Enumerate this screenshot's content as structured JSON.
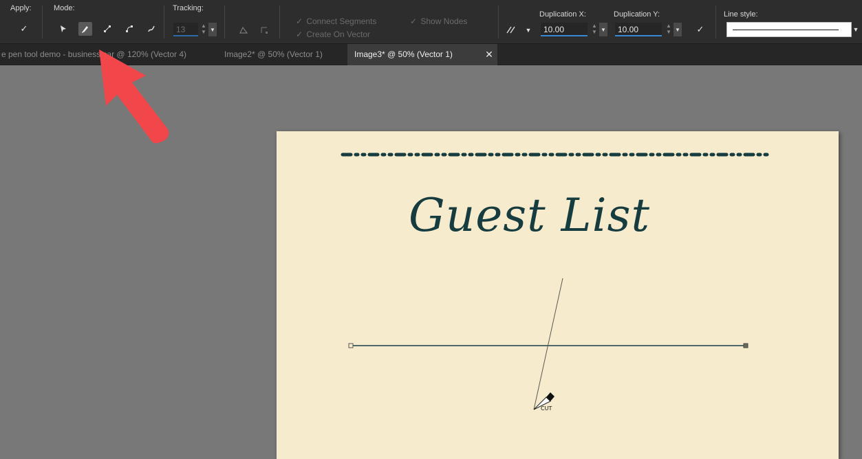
{
  "toolbar": {
    "apply_label": "Apply:",
    "apply_icon": "checkmark-icon",
    "mode_label": "Mode:",
    "mode_icons": [
      "node-edit-icon",
      "pen-icon",
      "line-segment-icon",
      "curve-segment-icon",
      "freehand-icon"
    ],
    "tracking_label": "Tracking:",
    "tracking_value": "13",
    "connect_segments_label": "Connect Segments",
    "create_on_vector_label": "Create On Vector",
    "show_nodes_label": "Show Nodes",
    "dup_x_label": "Duplication X:",
    "dup_x_value": "10.00",
    "dup_y_label": "Duplication Y:",
    "dup_y_value": "10.00",
    "line_style_label": "Line style:",
    "accent_color": "#3a87d6"
  },
  "tabs": [
    {
      "label": "e pen tool demo - business car @ 120% (Vector 4)"
    },
    {
      "label": "Image2* @  50% (Vector 1)"
    },
    {
      "label": "Image3* @  50% (Vector 1)"
    }
  ],
  "close_glyph": "✕",
  "document": {
    "title": "Guest List",
    "title_color": "#173c40",
    "paper_color": "#f6ebcd",
    "cursor_label": "CUT"
  },
  "annotation": {
    "arrow_color": "#f2474a"
  }
}
